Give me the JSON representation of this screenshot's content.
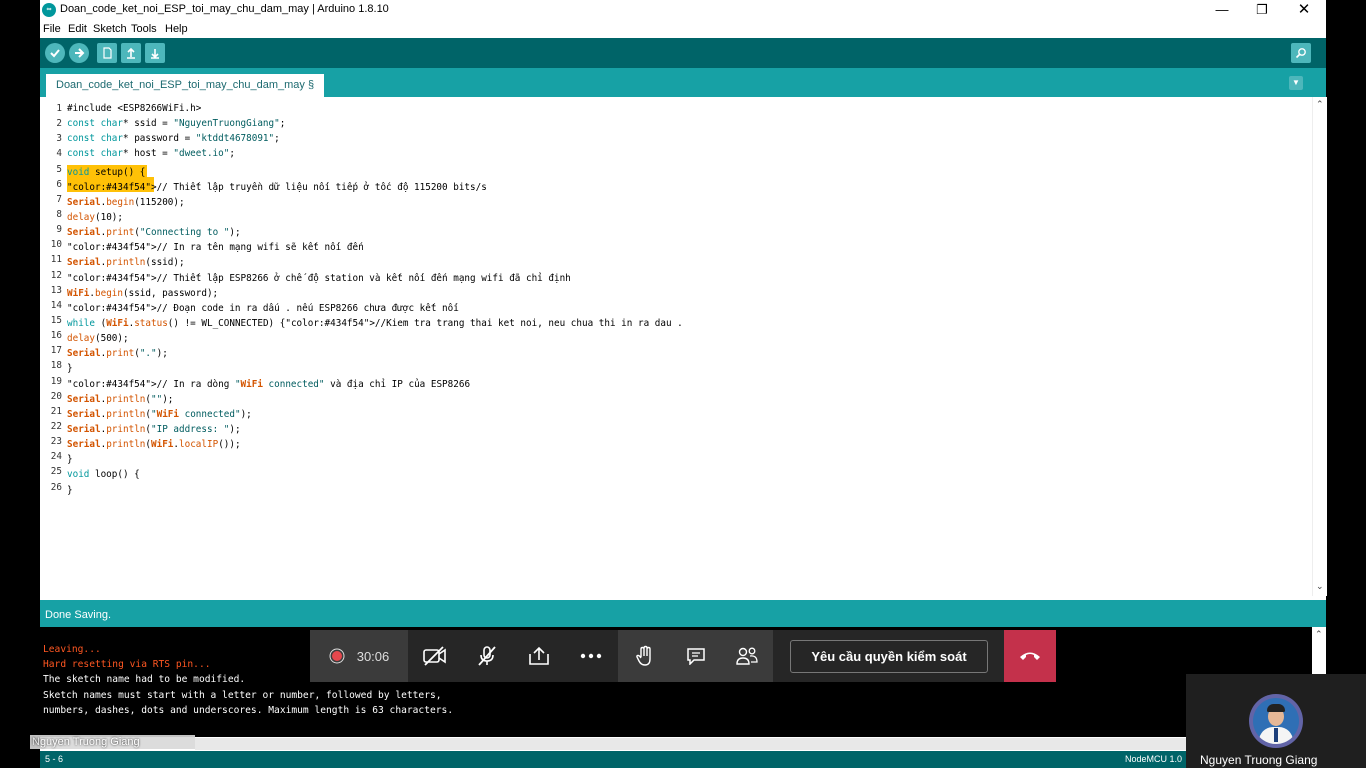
{
  "window": {
    "title": "Doan_code_ket_noi_ESP_toi_may_chu_dam_may | Arduino 1.8.10",
    "app_icon_text": "∞"
  },
  "menu": [
    "File",
    "Edit",
    "Sketch",
    "Tools",
    "Help"
  ],
  "tab": {
    "label": "Doan_code_ket_noi_ESP_toi_may_chu_dam_may §"
  },
  "code_lines": [
    "#include <ESP8266WiFi.h>",
    "const char* ssid = \"NguyenTruongGiang\";",
    "const char* password = \"ktddt4678091\";",
    "const char* host = \"dweet.io\";",
    "void setup() {",
    "// Thiết lập truyền dữ liệu nối tiếp ở tốc độ 115200 bits/s",
    "Serial.begin(115200);",
    "delay(10);",
    "Serial.print(\"Connecting to \");",
    "// In ra tên mạng wifi sẽ kết nối đến",
    "Serial.println(ssid);",
    "// Thiết lập ESP8266 ở chế độ station và kết nối đến mạng wifi đã chỉ định",
    "WiFi.begin(ssid, password);",
    "// Đoạn code in ra dấu . nếu ESP8266 chưa được kết nối",
    "while (WiFi.status() != WL_CONNECTED) {//Kiem tra trang thai ket noi, neu chua thi in ra dau .",
    "delay(500);",
    "Serial.print(\".\");",
    "}",
    "// In ra dòng \"WiFi connected\" và địa chỉ IP của ESP8266",
    "Serial.println(\"\");",
    "Serial.println(\"WiFi connected\");",
    "Serial.println(\"IP address: \");",
    "Serial.println(WiFi.localIP());",
    "}",
    "void loop() {",
    "}"
  ],
  "status": {
    "message": "Done Saving."
  },
  "console_lines": [
    {
      "text": "Leaving...",
      "color": "#ff5722"
    },
    {
      "text": "Hard resetting via RTS pin...",
      "color": "#ff5722"
    },
    {
      "text": "The sketch name had to be modified.",
      "color": "#ffffff"
    },
    {
      "text": "Sketch names must start with a letter or number, followed by letters,",
      "color": "#ffffff"
    },
    {
      "text": "numbers, dashes, dots and underscores. Maximum length is 63 characters.",
      "color": "#ffffff"
    }
  ],
  "bottom_bar": {
    "cursor_position": "5 - 6",
    "board": "NodeMCU 1.0"
  },
  "meeting": {
    "timer": "30:06",
    "request_control_label": "Yêu cầu quyền kiểm soát",
    "presenter_name_overlay": "Nguyen Truong Giang",
    "participant_name": "Nguyen Truong Giang"
  },
  "colors": {
    "toolbar": "#006468",
    "tab_bar": "#17a1a5",
    "highlight": "#ffc107",
    "keyword": "#00979c",
    "function": "#d35400",
    "string": "#005c5f",
    "end_call": "#c4314b"
  }
}
